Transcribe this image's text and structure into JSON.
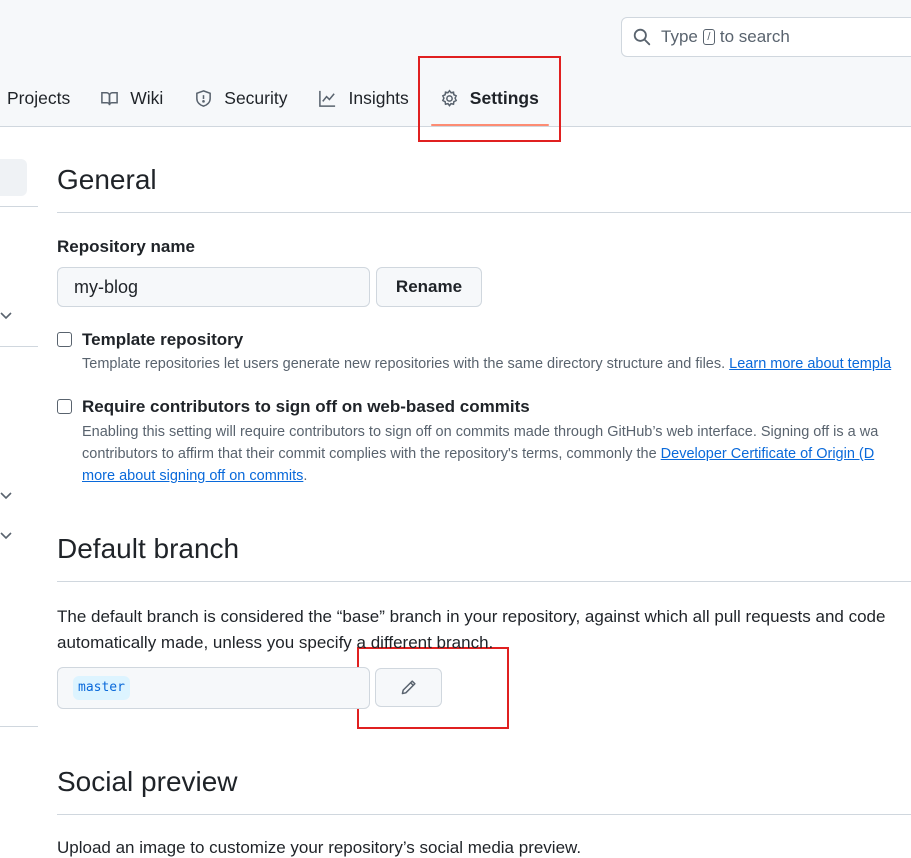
{
  "search": {
    "prefix": "Type",
    "slash": "/",
    "suffix": "to search"
  },
  "tabs": [
    {
      "label": "Projects",
      "icon": "table-icon"
    },
    {
      "label": "Wiki",
      "icon": "book-icon"
    },
    {
      "label": "Security",
      "icon": "shield-icon"
    },
    {
      "label": "Insights",
      "icon": "graph-icon"
    },
    {
      "label": "Settings",
      "icon": "gear-icon",
      "active": true
    }
  ],
  "general": {
    "heading": "General",
    "repo_name_label": "Repository name",
    "repo_name_value": "my-blog",
    "rename_button": "Rename",
    "template": {
      "title": "Template repository",
      "desc": "Template repositories let users generate new repositories with the same directory structure and files.",
      "link": "Learn more about templa"
    },
    "signoff": {
      "title": "Require contributors to sign off on web-based commits",
      "desc_line1": "Enabling this setting will require contributors to sign off on commits made through GitHub’s web interface. Signing off is a wa",
      "desc_line2_text": "contributors to affirm that their commit complies with the repository's terms, commonly the",
      "desc_line2_link": "Developer Certificate of Origin (D",
      "desc_line3_link": "more about signing off on commits",
      "desc_line3_end": "."
    }
  },
  "default_branch": {
    "heading": "Default branch",
    "para_line1": "The default branch is considered the “base” branch in your repository, against which all pull requests and code",
    "para_line2": "automatically made, unless you specify a different branch.",
    "branch": "master",
    "edit_icon": "pencil-icon"
  },
  "social_preview": {
    "heading": "Social preview",
    "desc": "Upload an image to customize your repository’s social media preview."
  },
  "colors": {
    "accent_underline": "#fd8c73",
    "link": "#0969da",
    "highlight_box": "#e02020"
  }
}
